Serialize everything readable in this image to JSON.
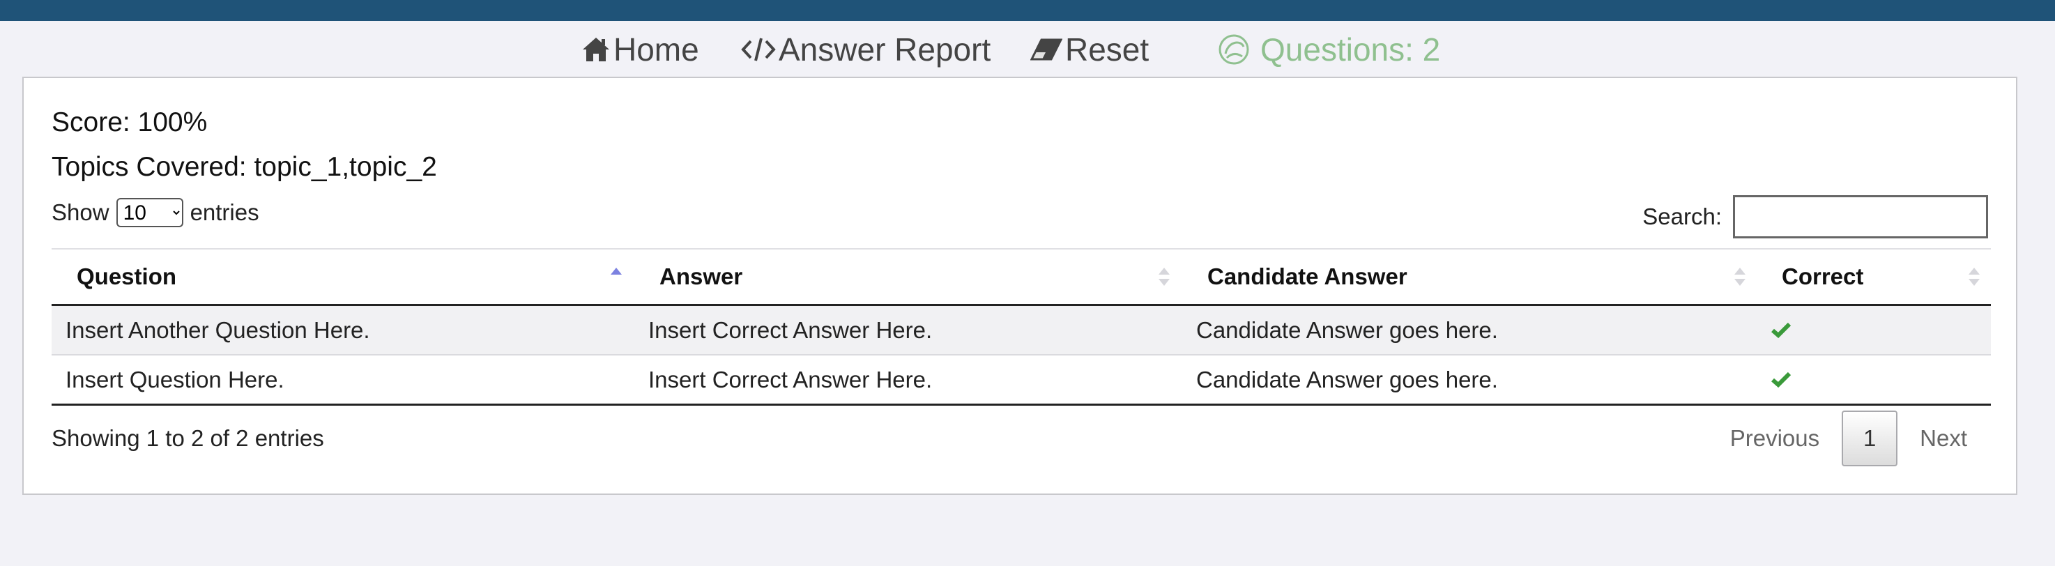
{
  "nav": {
    "home": "Home",
    "answer_report": "Answer Report",
    "reset": "Reset",
    "questions": "Questions: 2"
  },
  "summary": {
    "score": "Score: 100%",
    "topics": "Topics Covered: topic_1,topic_2"
  },
  "table_controls": {
    "show_label": "Show",
    "entries_label": "entries",
    "page_length": "10",
    "search_label": "Search:",
    "search_value": ""
  },
  "table": {
    "columns": [
      "Question",
      "Answer",
      "Candidate Answer",
      "Correct"
    ],
    "sorted_column": "Question",
    "sort_direction": "ascending",
    "rows": [
      {
        "question": "Insert Another Question Here.",
        "answer": "Insert Correct Answer Here.",
        "candidate_answer": "Candidate Answer goes here.",
        "correct": "check-icon"
      },
      {
        "question": "Insert Question Here.",
        "answer": "Insert Correct Answer Here.",
        "candidate_answer": "Candidate Answer goes here.",
        "correct": "check-icon"
      }
    ]
  },
  "footer": {
    "info": "Showing 1 to 2 of 2 entries",
    "previous": "Previous",
    "page": "1",
    "next": "Next"
  },
  "colors": {
    "top_bar": "#1f5378",
    "check": "#3a9a3a",
    "questions_accent": "#8fc08f",
    "sort_active": "#7c82e0"
  }
}
